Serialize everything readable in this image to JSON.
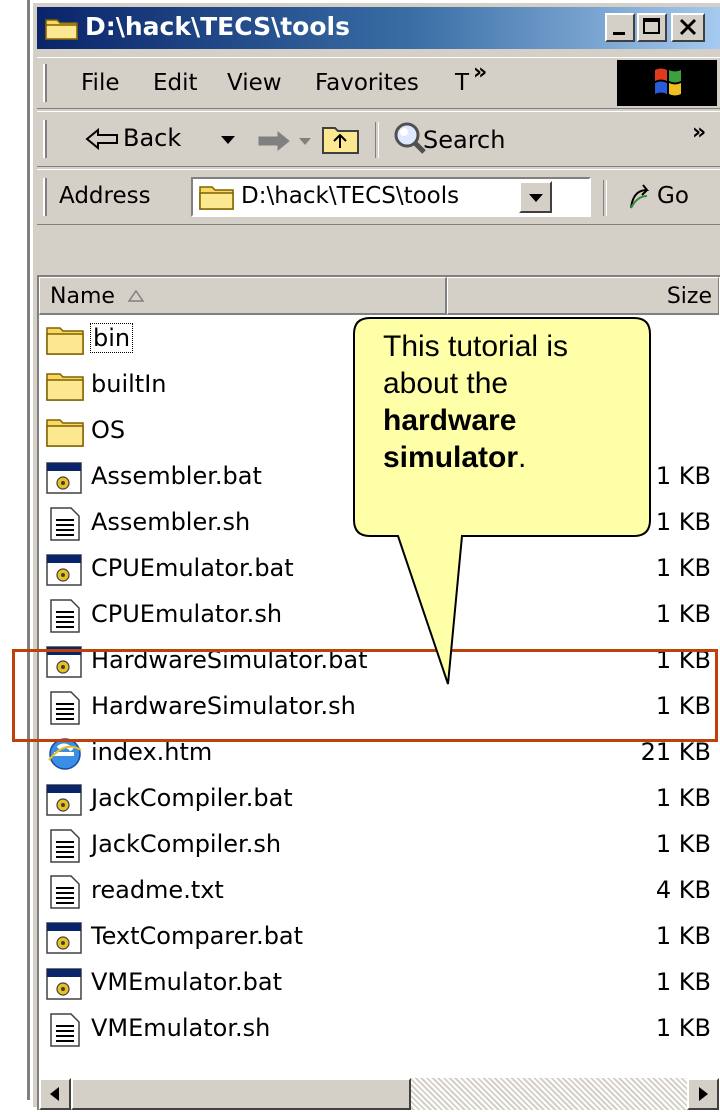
{
  "window": {
    "title": "D:\\hack\\TECS\\tools",
    "controls": [
      "minimize",
      "maximize",
      "close"
    ]
  },
  "menu": {
    "items": [
      "File",
      "Edit",
      "View",
      "Favorites",
      "T"
    ],
    "overflow": "»"
  },
  "toolbar": {
    "back_label": "Back",
    "search_label": "Search",
    "overflow": "»"
  },
  "address": {
    "label": "Address",
    "value": "D:\\hack\\TECS\\tools",
    "go_label": "Go"
  },
  "columns": {
    "name": "Name",
    "size": "Size"
  },
  "files": [
    {
      "name": "bin",
      "size": "",
      "type": "folder"
    },
    {
      "name": "builtIn",
      "size": "",
      "type": "folder"
    },
    {
      "name": "OS",
      "size": "",
      "type": "folder"
    },
    {
      "name": "Assembler.bat",
      "size": "1 KB",
      "type": "bat"
    },
    {
      "name": "Assembler.sh",
      "size": "1 KB",
      "type": "sh"
    },
    {
      "name": "CPUEmulator.bat",
      "size": "1 KB",
      "type": "bat"
    },
    {
      "name": "CPUEmulator.sh",
      "size": "1 KB",
      "type": "sh"
    },
    {
      "name": "HardwareSimulator.bat",
      "size": "1 KB",
      "type": "bat"
    },
    {
      "name": "HardwareSimulator.sh",
      "size": "1 KB",
      "type": "sh"
    },
    {
      "name": "index.htm",
      "size": "21 KB",
      "type": "htm"
    },
    {
      "name": "JackCompiler.bat",
      "size": "1 KB",
      "type": "bat"
    },
    {
      "name": "JackCompiler.sh",
      "size": "1 KB",
      "type": "sh"
    },
    {
      "name": "readme.txt",
      "size": "4 KB",
      "type": "txt"
    },
    {
      "name": "TextComparer.bat",
      "size": "1 KB",
      "type": "bat"
    },
    {
      "name": "VMEmulator.bat",
      "size": "1 KB",
      "type": "bat"
    },
    {
      "name": "VMEmulator.sh",
      "size": "1 KB",
      "type": "sh"
    }
  ],
  "callout": {
    "line1": "This tutorial is",
    "line2": "about the",
    "bold1": "hardware",
    "bold2": "simulator",
    "end": ".",
    "border_color": "#000000",
    "fill_color": "#ffffa8"
  },
  "highlight_color": "#c0400a"
}
